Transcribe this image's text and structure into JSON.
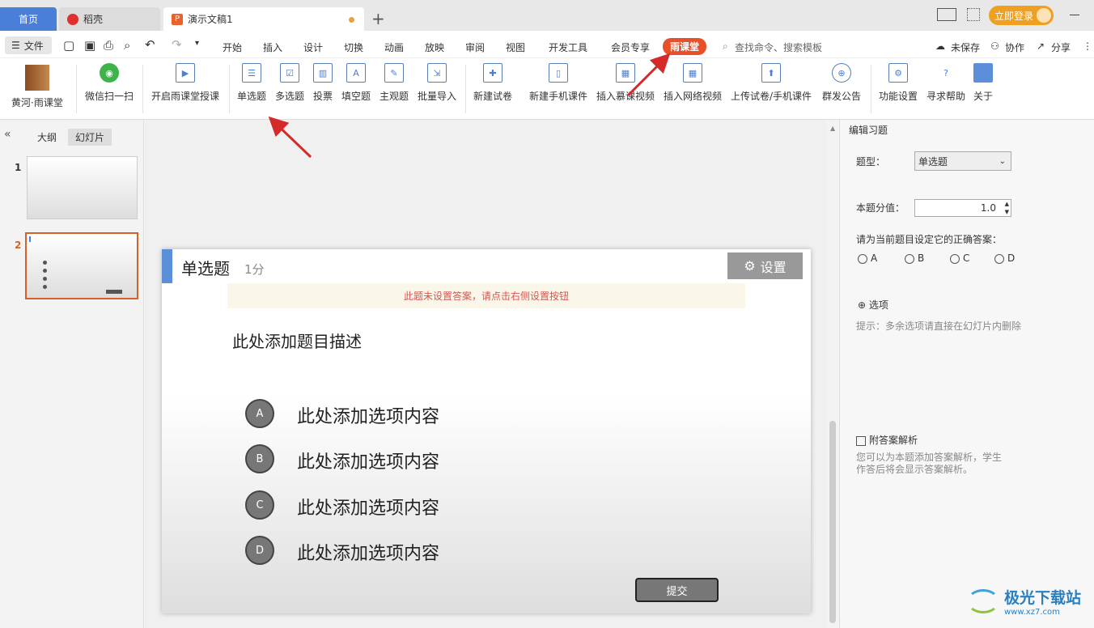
{
  "tabs": {
    "home": "首页",
    "daoke": "稻壳",
    "doc": "演示文稿1",
    "new": "+"
  },
  "titlebar": {
    "login": "立即登录"
  },
  "menu": {
    "file": "文件",
    "items": [
      "开始",
      "插入",
      "设计",
      "切换",
      "动画",
      "放映",
      "审阅",
      "视图",
      "开发工具",
      "会员专享",
      "雨课堂"
    ],
    "search": "查找命令、搜索模板",
    "unsaved": "未保存",
    "collab": "协作",
    "share": "分享"
  },
  "ribbon": {
    "items": [
      "黄河·雨课堂",
      "微信扫一扫",
      "开启雨课堂授课",
      "单选题",
      "多选题",
      "投票",
      "填空题",
      "主观题",
      "批量导入",
      "新建试卷",
      "新建手机课件",
      "插入慕课视频",
      "插入网络视频",
      "上传试卷/手机课件",
      "群发公告",
      "功能设置",
      "寻求帮助",
      "关于"
    ]
  },
  "leftpanel": {
    "outline": "大纲",
    "slides": "幻灯片",
    "slide_numbers": [
      "1",
      "2"
    ]
  },
  "slide": {
    "title": "单选题",
    "score": "1分",
    "settings": "设置",
    "warning": "此题未设置答案，请点击右侧设置按钮",
    "question": "此处添加题目描述",
    "options": [
      {
        "letter": "A",
        "text": "此处添加选项内容"
      },
      {
        "letter": "B",
        "text": "此处添加选项内容"
      },
      {
        "letter": "C",
        "text": "此处添加选项内容"
      },
      {
        "letter": "D",
        "text": "此处添加选项内容"
      }
    ],
    "submit": "提交"
  },
  "rightpanel": {
    "header": "编辑习题",
    "type_label": "题型：",
    "type_value": "单选题",
    "score_label": "本题分值：",
    "score_value": "1.0",
    "answer_label": "请为当前题目设定它的正确答案：",
    "answers": [
      "A",
      "B",
      "C",
      "D"
    ],
    "add_option": "选项",
    "hint": "提示：多余选项请直接在幻灯片内删除",
    "analysis_label": "附答案解析",
    "analysis_desc": "您可以为本题添加答案解析，学生作答后将会显示答案解析。"
  },
  "watermark": {
    "text": "极光下载站",
    "url": "www.xz7.com"
  },
  "colors": {
    "accent": "#4a7fd9",
    "yuketang": "#e8502a",
    "arrow": "#d42a2a"
  }
}
